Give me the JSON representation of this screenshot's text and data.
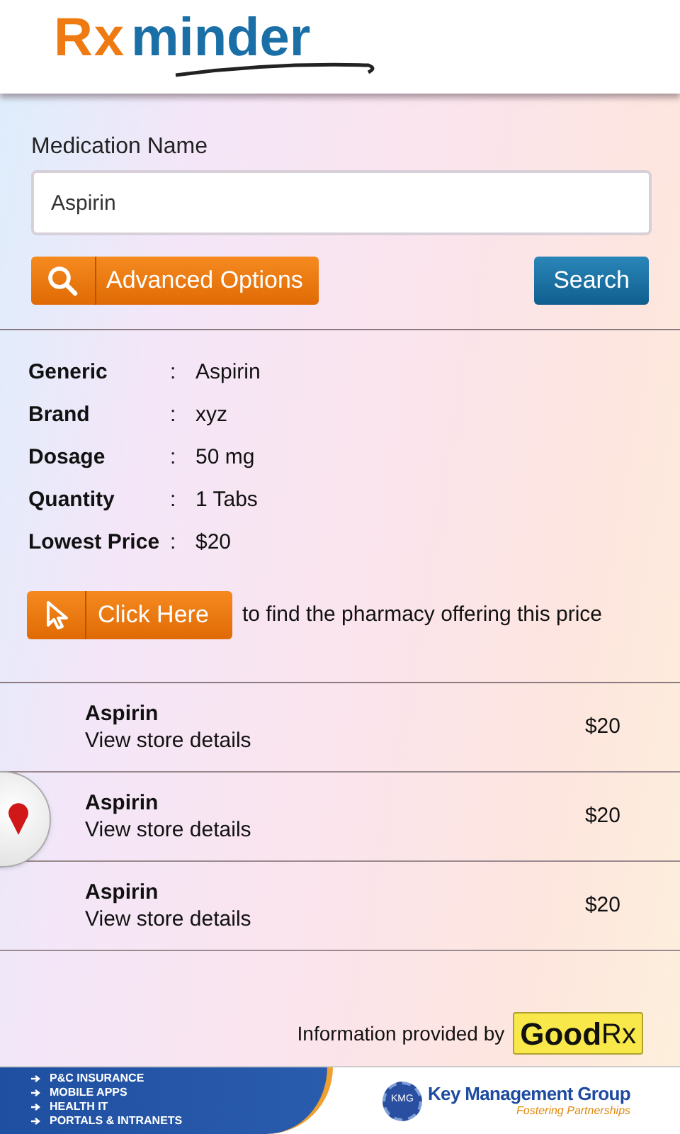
{
  "header": {
    "logo_rx": "Rx",
    "logo_minder": "minder"
  },
  "search": {
    "label": "Medication Name",
    "value": "Aspirin",
    "advanced_button": "Advanced Options",
    "search_button": "Search"
  },
  "details": [
    {
      "label": "Generic",
      "separator": ":",
      "value": "Aspirin"
    },
    {
      "label": "Brand",
      "separator": ":",
      "value": "xyz"
    },
    {
      "label": "Dosage",
      "separator": ":",
      "value": "50 mg"
    },
    {
      "label": "Quantity",
      "separator": ":",
      "value": "1 Tabs"
    },
    {
      "label": "Lowest Price",
      "separator": ":",
      "value": "$20"
    }
  ],
  "click_here": {
    "button": "Click Here",
    "text": "to find the pharmacy offering this price"
  },
  "results": [
    {
      "name": "Aspirin",
      "link": "View store details",
      "price": "$20"
    },
    {
      "name": "Aspirin",
      "link": "View store details",
      "price": "$20"
    },
    {
      "name": "Aspirin",
      "link": "View store details",
      "price": "$20"
    }
  ],
  "credit": {
    "text": "Information provided by",
    "logo_good": "Good",
    "logo_rx": "Rx"
  },
  "footer": {
    "services": [
      "P&C INSURANCE",
      "MOBILE APPS",
      "HEALTH IT",
      "PORTALS & INTRANETS"
    ],
    "badge": "KMG",
    "company": "Key Management Group",
    "tagline": "Fostering Partnerships"
  }
}
